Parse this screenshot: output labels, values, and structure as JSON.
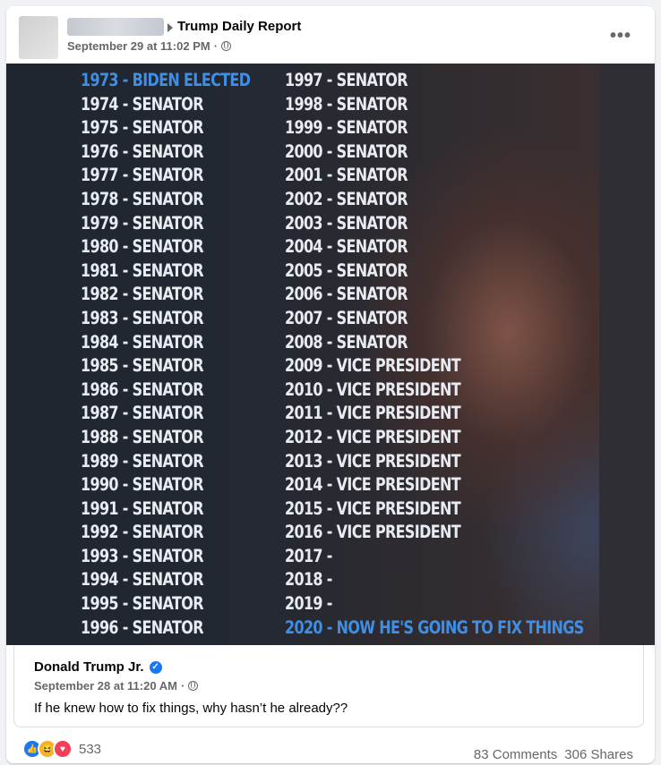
{
  "post": {
    "group_name": "Trump Daily Report",
    "timestamp": "September 29 at 11:02 PM",
    "separator": "·",
    "more_label": "•••"
  },
  "image_text": {
    "col1": [
      "1973 - BIDEN ELECTED",
      "1974 - SENATOR",
      "1975 - SENATOR",
      "1976 - SENATOR",
      "1977 - SENATOR",
      "1978 - SENATOR",
      "1979 - SENATOR",
      "1980 - SENATOR",
      "1981 - SENATOR",
      "1982 - SENATOR",
      "1983 - SENATOR",
      "1984 - SENATOR",
      "1985 - SENATOR",
      "1986 - SENATOR",
      "1987 - SENATOR",
      "1988 - SENATOR",
      "1989 - SENATOR",
      "1990 - SENATOR",
      "1991 - SENATOR",
      "1992 - SENATOR",
      "1993 - SENATOR",
      "1994 - SENATOR",
      "1995 - SENATOR",
      "1996 - SENATOR"
    ],
    "col2": [
      "1997 - SENATOR",
      "1998 - SENATOR",
      "1999 - SENATOR",
      "2000 - SENATOR",
      "2001 - SENATOR",
      "2002 - SENATOR",
      "2003 - SENATOR",
      "2004 - SENATOR",
      "2005 - SENATOR",
      "2006 - SENATOR",
      "2007 - SENATOR",
      "2008 - SENATOR",
      "2009 - VICE PRESIDENT",
      "2010 - VICE PRESIDENT",
      "2011 - VICE PRESIDENT",
      "2012 - VICE PRESIDENT",
      "2013 - VICE PRESIDENT",
      "2014 - VICE PRESIDENT",
      "2015 - VICE PRESIDENT",
      "2016 - VICE PRESIDENT",
      "2017 -",
      "2018 -",
      "2019 -",
      "2020 - NOW HE'S GOING TO FIX THINGS"
    ]
  },
  "shared_post": {
    "author": "Donald Trump Jr.",
    "verified_icon": "✓",
    "timestamp": "September 28 at 11:20 AM",
    "separator": "·",
    "text": "If he knew how to fix things, why hasn’t he already??"
  },
  "footer": {
    "reaction_count": "533",
    "comments": "83 Comments",
    "shares": "306 Shares"
  },
  "colors": {
    "highlight": "#3f8fe6",
    "link_blue": "#1877f2"
  }
}
